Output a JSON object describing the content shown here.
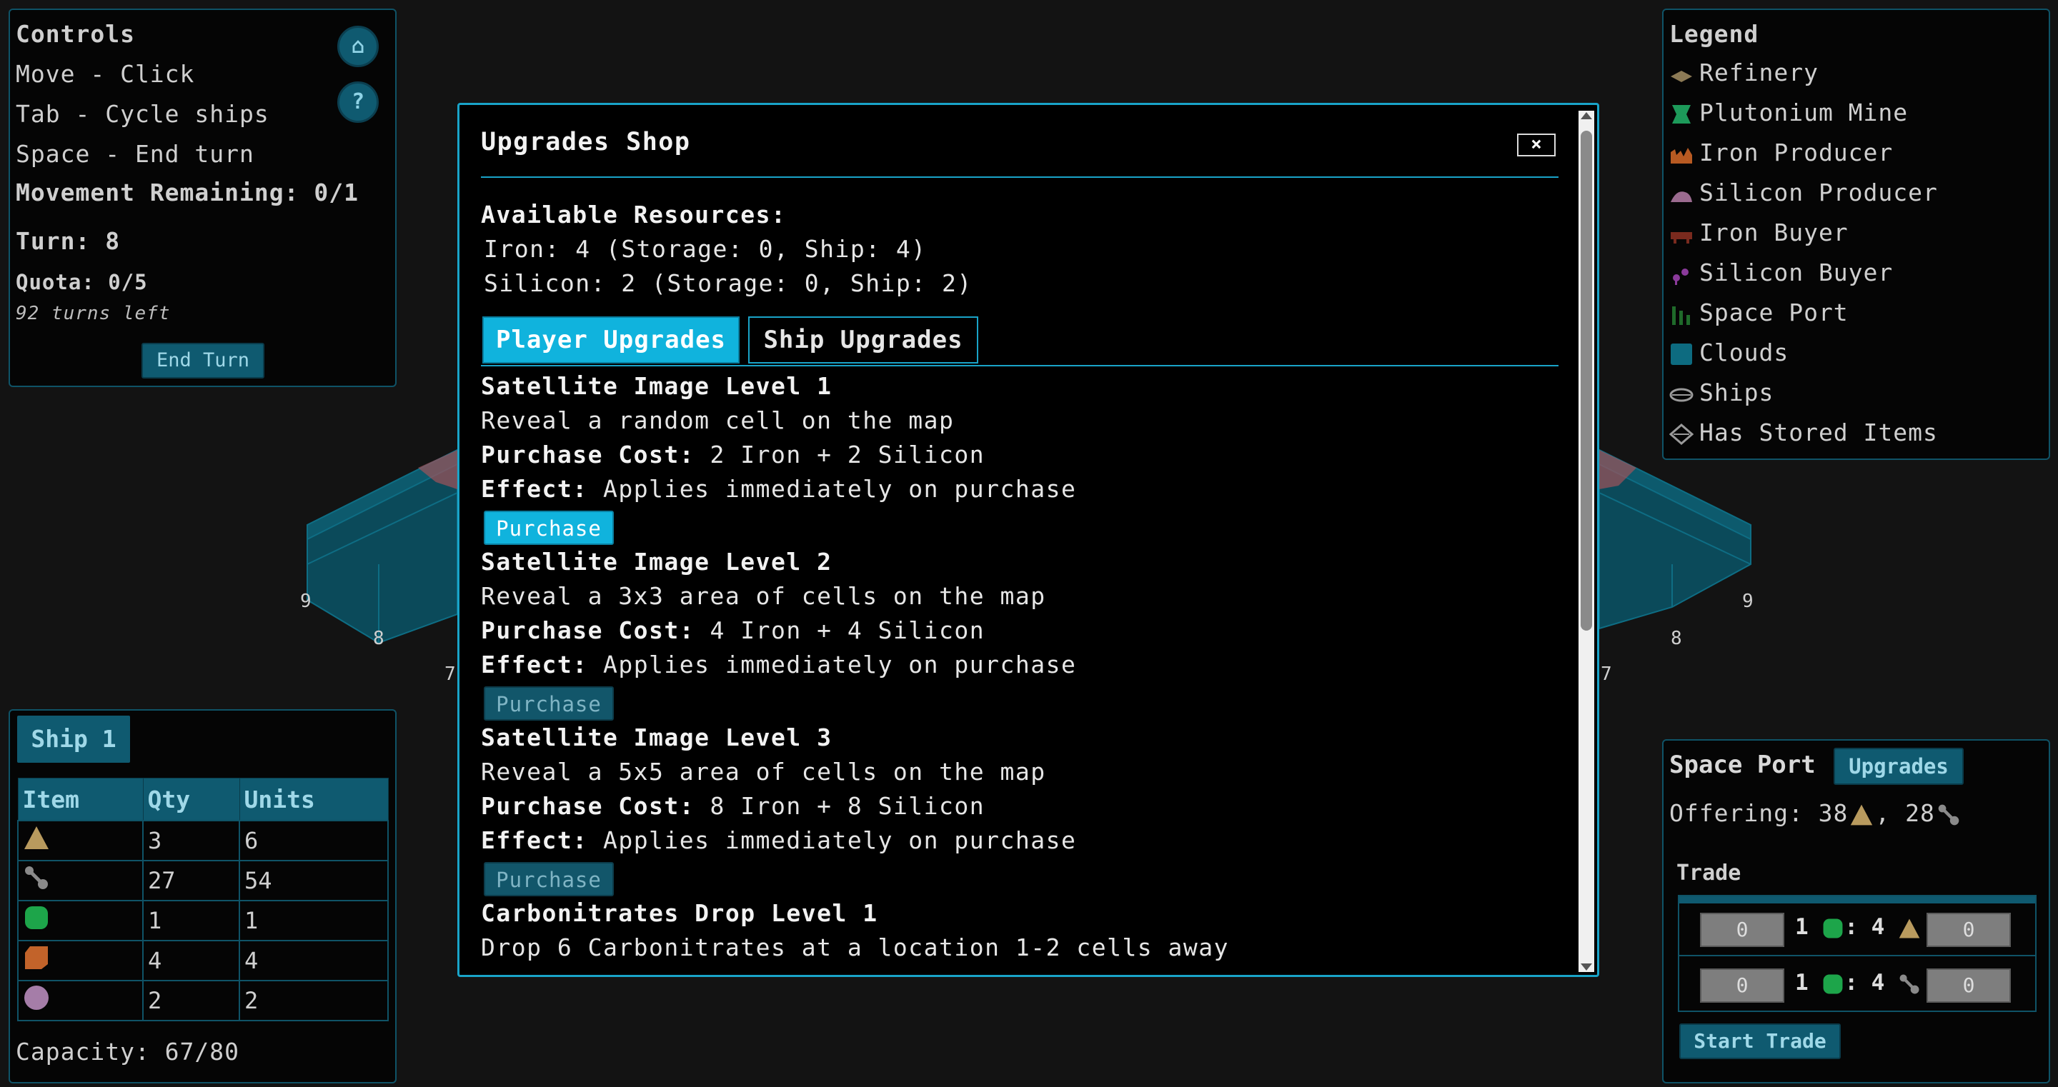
{
  "controls": {
    "title": "Controls",
    "move": "Move - Click",
    "tab": "Tab - Cycle ships",
    "space": "Space - End turn",
    "movement": "Movement Remaining: 0/1",
    "turn": "Turn: 8",
    "quota": "Quota: 0/5",
    "turns_left": "92 turns left",
    "end_turn": "End Turn",
    "home_icon": "⌂",
    "help_icon": "?"
  },
  "legend": {
    "title": "Legend",
    "items": [
      {
        "label": "Refinery",
        "icon": "refinery-icon",
        "color": "#8c7a55"
      },
      {
        "label": "Plutonium Mine",
        "icon": "plutonium-mine-icon",
        "color": "#1d9a5a"
      },
      {
        "label": "Iron Producer",
        "icon": "iron-producer-icon",
        "color": "#b85a22"
      },
      {
        "label": "Silicon Producer",
        "icon": "silicon-producer-icon",
        "color": "#9b6b8f"
      },
      {
        "label": "Iron Buyer",
        "icon": "iron-buyer-icon",
        "color": "#7a2a1e"
      },
      {
        "label": "Silicon Buyer",
        "icon": "silicon-buyer-icon",
        "color": "#8a3a9a"
      },
      {
        "label": "Space Port",
        "icon": "space-port-icon",
        "color": "#1f6a2a"
      },
      {
        "label": "Clouds",
        "icon": "clouds-icon",
        "color": "#0d6b80"
      },
      {
        "label": "Ships",
        "icon": "ships-icon",
        "color": "#9a9a9a"
      },
      {
        "label": "Has Stored Items",
        "icon": "stored-items-icon",
        "color": "#9a9a9a"
      }
    ]
  },
  "board": {
    "left_labels": [
      "9",
      "8",
      "7"
    ],
    "right_labels": [
      "9",
      "8",
      "7"
    ]
  },
  "ship": {
    "tab": "Ship 1",
    "headers": [
      "Item",
      "Qty",
      "Units"
    ],
    "rows": [
      {
        "icon": "plutonium-triangle-icon",
        "qty": "3",
        "units": "6"
      },
      {
        "icon": "silicon-molecule-icon",
        "qty": "27",
        "units": "54"
      },
      {
        "icon": "green-barrel-icon",
        "qty": "1",
        "units": "1"
      },
      {
        "icon": "iron-ore-icon",
        "qty": "4",
        "units": "4"
      },
      {
        "icon": "purple-orb-icon",
        "qty": "2",
        "units": "2"
      }
    ],
    "capacity": "Capacity: 67/80"
  },
  "spaceport": {
    "title": "Space Port",
    "upgrades_btn": "Upgrades",
    "offering_prefix": "Offering: 38",
    "offering_mid": ", 28",
    "trade_title": "Trade",
    "trade_rows": [
      {
        "left": "0",
        "ratio_a": "1",
        "ratio_b": ": 4",
        "right": "0",
        "target_icon": "plutonium-triangle-icon"
      },
      {
        "left": "0",
        "ratio_a": "1",
        "ratio_b": ": 4",
        "right": "0",
        "target_icon": "silicon-molecule-icon"
      }
    ],
    "start_trade": "Start Trade"
  },
  "modal": {
    "title": "Upgrades Shop",
    "close": "×",
    "resources_title": "Available Resources:",
    "iron_line": "Iron: 4 (Storage: 0, Ship: 4)",
    "silicon_line": "Silicon: 2 (Storage: 0, Ship: 2)",
    "tabs": [
      "Player Upgrades",
      "Ship Upgrades"
    ],
    "upgrades": [
      {
        "name": "Satellite Image Level 1",
        "desc": "Reveal a random cell on the map",
        "cost_label": "Purchase Cost:",
        "cost": "2 Iron + 2 Silicon",
        "effect_label": "Effect:",
        "effect": "Applies immediately on purchase",
        "button": "Purchase",
        "enabled": true
      },
      {
        "name": "Satellite Image Level 2",
        "desc": "Reveal a 3x3 area of cells on the map",
        "cost_label": "Purchase Cost:",
        "cost": "4 Iron + 4 Silicon",
        "effect_label": "Effect:",
        "effect": "Applies immediately on purchase",
        "button": "Purchase",
        "enabled": false
      },
      {
        "name": "Satellite Image Level 3",
        "desc": "Reveal a 5x5 area of cells on the map",
        "cost_label": "Purchase Cost:",
        "cost": "8 Iron + 8 Silicon",
        "effect_label": "Effect:",
        "effect": "Applies immediately on purchase",
        "button": "Purchase",
        "enabled": false
      },
      {
        "name": "Carbonitrates Drop Level 1",
        "desc": "Drop 6 Carbonitrates at a location 1-2 cells away"
      }
    ]
  }
}
